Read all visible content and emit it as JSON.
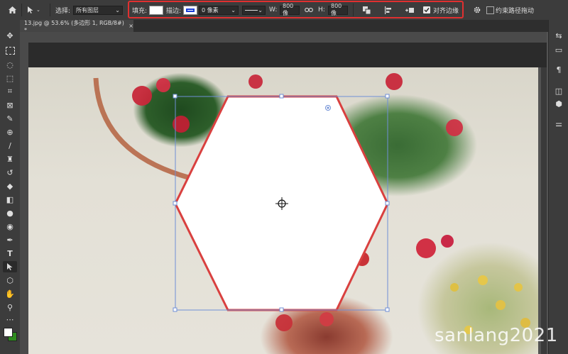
{
  "options_bar": {
    "select_label": "选择:",
    "select_value": "所有图层",
    "fill_label": "填充:",
    "stroke_label": "描边:",
    "stroke_width_value": "0 像素",
    "w_label": "W:",
    "w_value": "800 像",
    "h_label": "H:",
    "h_value": "800 像",
    "align_edges_label": "对齐边缘",
    "constrain_path_label": "约束路径拖动"
  },
  "document_tab": {
    "title": "13.jpg @ 53.6% (多边形 1, RGB/8#) *",
    "close": "×"
  },
  "watermark": "sanlang2021",
  "colors": {
    "stroke_red": "#d9403f",
    "path_blue": "#6f8fd6",
    "highlight_red": "#e03030",
    "foreground": "#ffffff",
    "background_swatch": "#2e8b1e"
  }
}
